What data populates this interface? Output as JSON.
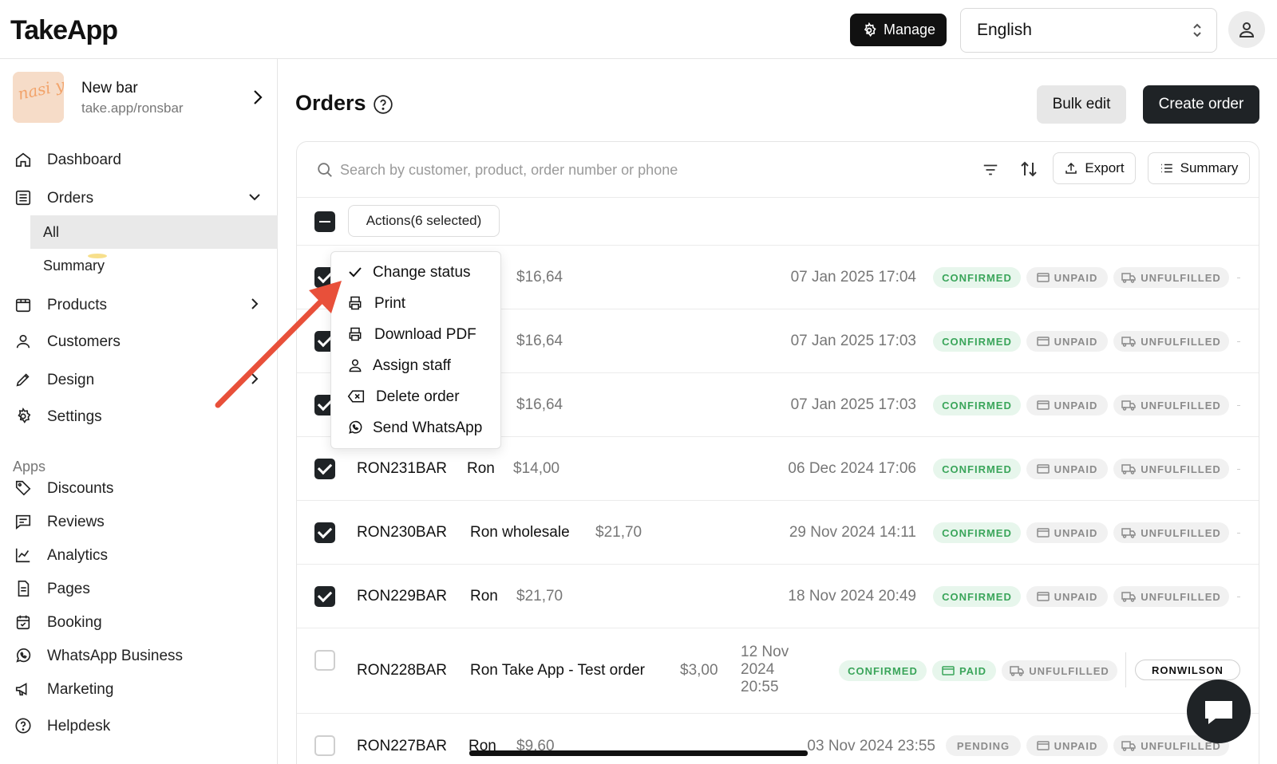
{
  "app": {
    "logo": "TakeApp"
  },
  "header": {
    "manage_label": "Manage",
    "language": "English"
  },
  "store": {
    "logo_text": "nasi yamn",
    "name": "New bar",
    "url": "take.app/ronsbar"
  },
  "nav": {
    "dashboard": "Dashboard",
    "orders": "Orders",
    "orders_all": "All",
    "orders_summary": "Summary",
    "products": "Products",
    "customers": "Customers",
    "design": "Design",
    "settings": "Settings",
    "apps_section": "Apps",
    "discounts": "Discounts",
    "reviews": "Reviews",
    "analytics": "Analytics",
    "pages": "Pages",
    "booking": "Booking",
    "whatsapp_business": "WhatsApp Business",
    "marketing": "Marketing",
    "helpdesk": "Helpdesk"
  },
  "page": {
    "title": "Orders",
    "bulk_edit": "Bulk edit",
    "create_order": "Create order"
  },
  "toolbar": {
    "search_placeholder": "Search by customer, product, order number or phone",
    "export": "Export",
    "summary": "Summary",
    "actions": "Actions(6 selected)"
  },
  "menu": {
    "change_status": "Change status",
    "print": "Print",
    "download_pdf": "Download PDF",
    "assign_staff": "Assign staff",
    "delete_order": "Delete order",
    "send_whatsapp": "Send WhatsApp"
  },
  "orders": [
    {
      "number": "",
      "customer": "",
      "price": "$16,64",
      "date": "07 Jan 2025 17:04",
      "status": "CONFIRMED",
      "payment": "UNPAID",
      "fulfillment": "UNFULFILLED",
      "checked": true
    },
    {
      "number": "",
      "customer": "",
      "price": "$16,64",
      "date": "07 Jan 2025 17:03",
      "status": "CONFIRMED",
      "payment": "UNPAID",
      "fulfillment": "UNFULFILLED",
      "checked": true
    },
    {
      "number": "",
      "customer": "",
      "price": "$16,64",
      "date": "07 Jan 2025 17:03",
      "status": "CONFIRMED",
      "payment": "UNPAID",
      "fulfillment": "UNFULFILLED",
      "checked": true
    },
    {
      "number": "RON231BAR",
      "customer": "Ron",
      "price": "$14,00",
      "date": "06 Dec 2024 17:06",
      "status": "CONFIRMED",
      "payment": "UNPAID",
      "fulfillment": "UNFULFILLED",
      "checked": true
    },
    {
      "number": "RON230BAR",
      "customer": "Ron wholesale",
      "price": "$21,70",
      "date": "29 Nov 2024 14:11",
      "status": "CONFIRMED",
      "payment": "UNPAID",
      "fulfillment": "UNFULFILLED",
      "checked": true
    },
    {
      "number": "RON229BAR",
      "customer": "Ron",
      "price": "$21,70",
      "date": "18 Nov 2024 20:49",
      "status": "CONFIRMED",
      "payment": "UNPAID",
      "fulfillment": "UNFULFILLED",
      "checked": true
    },
    {
      "number": "RON228BAR",
      "customer": "Ron Take App - Test order",
      "price": "$3,00",
      "date_line1": "12 Nov",
      "date_line2": "2024",
      "date_line3": "20:55",
      "status": "CONFIRMED",
      "payment": "PAID",
      "fulfillment": "UNFULFILLED",
      "staff": "RONWILSON",
      "checked": false
    },
    {
      "number": "RON227BAR",
      "customer": "Ron",
      "price": "$9,60",
      "date": "03 Nov 2024 23:55",
      "status": "PENDING",
      "payment": "UNPAID",
      "fulfillment": "UNFULFILLED",
      "checked": false
    }
  ],
  "colors": {
    "accent_dark": "#1f2326",
    "confirmed_green": "#3aa55a",
    "arrow_red": "#e8503a"
  }
}
